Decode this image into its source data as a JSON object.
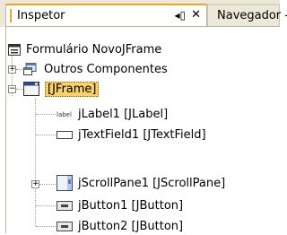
{
  "tabs": {
    "inspector_title": "Inspetor",
    "navigator_title": "Navegador -",
    "float_label": "◂▯",
    "close_label": "✕"
  },
  "tree": {
    "root_label": "Formulário NovoJFrame",
    "other_components_label": "Outros Componentes",
    "jframe_label": "[JFrame]",
    "children": [
      {
        "label": "jLabel1 [JLabel]",
        "icon": "label-icon",
        "icon_text": "label"
      },
      {
        "label": "jTextField1 [JTextField]",
        "icon": "textfield-icon"
      },
      {
        "label": "jScrollPane1 [JScrollPane]",
        "icon": "scrollpane-icon"
      },
      {
        "label": "jButton1 [JButton]",
        "icon": "button-icon"
      },
      {
        "label": "jButton2 [JButton]",
        "icon": "button-icon"
      }
    ]
  },
  "colors": {
    "tab_accent": "#f0a030",
    "selection": "#f8d070",
    "tab_background": "#ece9d8"
  }
}
